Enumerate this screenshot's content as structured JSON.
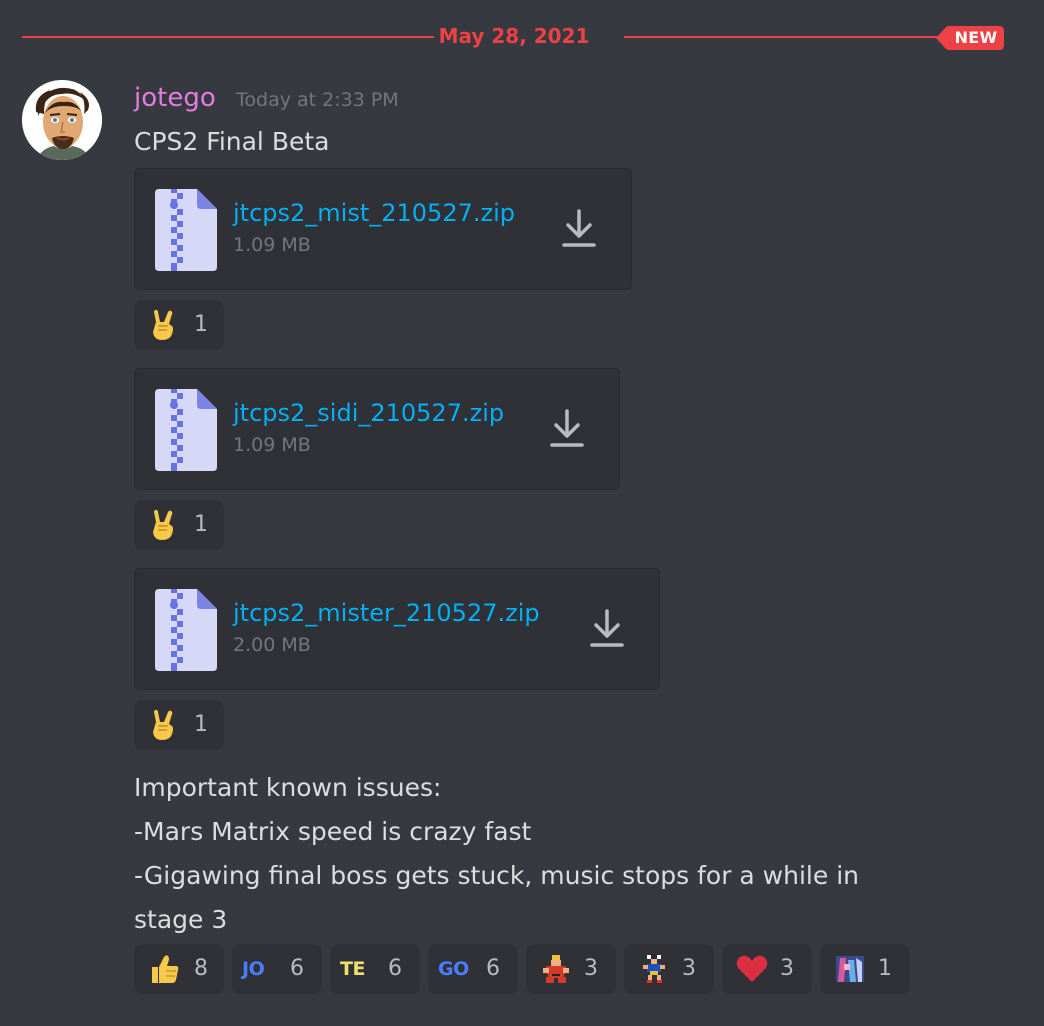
{
  "divider": {
    "date": "May 28, 2021",
    "badge": "NEW"
  },
  "message": {
    "username": "jotego",
    "timestamp": "Today at 2:33 PM",
    "text": "CPS2 Final Beta",
    "username_color": "#e47ce0"
  },
  "attachments": [
    {
      "name": "jtcps2_mist_210527.zip",
      "size": "1.09 MB",
      "icon": "zip-file-icon",
      "reaction": {
        "emoji": "sign-of-horns-emoji",
        "count": "1"
      }
    },
    {
      "name": "jtcps2_sidi_210527.zip",
      "size": "1.09 MB",
      "icon": "zip-file-icon",
      "reaction": {
        "emoji": "sign-of-horns-emoji",
        "count": "1"
      }
    },
    {
      "name": "jtcps2_mister_210527.zip",
      "size": "2.00 MB",
      "icon": "zip-file-icon",
      "reaction": {
        "emoji": "sign-of-horns-emoji",
        "count": "1"
      }
    }
  ],
  "issues": {
    "heading": "Important known issues:",
    "lines": [
      "-Mars Matrix speed is crazy fast",
      "-Gigawing final boss gets stuck, music stops for a while in",
      "stage 3"
    ]
  },
  "reactions": [
    {
      "emoji": "thumbs-up-emoji",
      "count": "8"
    },
    {
      "emoji": "jo-emoji",
      "label": "JO",
      "count": "6"
    },
    {
      "emoji": "te-emoji",
      "label": "TE",
      "count": "6"
    },
    {
      "emoji": "go-emoji",
      "label": "GO",
      "count": "6"
    },
    {
      "emoji": "fighter-sprite-emoji",
      "count": "3"
    },
    {
      "emoji": "chun-li-sprite-emoji",
      "count": "3"
    },
    {
      "emoji": "red-heart-emoji",
      "count": "3"
    },
    {
      "emoji": "pixel-art-emoji",
      "count": "1"
    }
  ],
  "colors": {
    "background": "#36393f",
    "attachment_bg": "#2f3136",
    "accent_red": "#ed4245",
    "link_blue": "#00aff4",
    "text": "#dcddde",
    "muted": "#72767d"
  }
}
